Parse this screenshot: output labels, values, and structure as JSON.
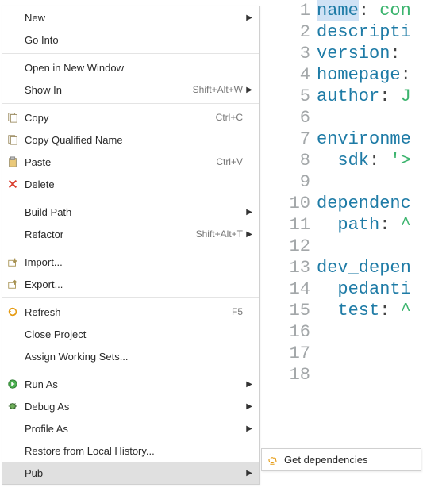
{
  "menu": {
    "groups": [
      [
        {
          "id": "new",
          "label": "New",
          "submenu": true,
          "icon": null,
          "accel": null
        },
        {
          "id": "go-into",
          "label": "Go Into",
          "submenu": false,
          "icon": null,
          "accel": null
        }
      ],
      [
        {
          "id": "open-new-window",
          "label": "Open in New Window",
          "submenu": false,
          "icon": null,
          "accel": null
        },
        {
          "id": "show-in",
          "label": "Show In",
          "submenu": true,
          "icon": null,
          "accel": "Shift+Alt+W"
        }
      ],
      [
        {
          "id": "copy",
          "label": "Copy",
          "submenu": false,
          "icon": "copy",
          "accel": "Ctrl+C"
        },
        {
          "id": "copy-qualified",
          "label": "Copy Qualified Name",
          "submenu": false,
          "icon": "copy",
          "accel": null
        },
        {
          "id": "paste",
          "label": "Paste",
          "submenu": false,
          "icon": "paste",
          "accel": "Ctrl+V"
        },
        {
          "id": "delete",
          "label": "Delete",
          "submenu": false,
          "icon": "delete",
          "accel": null
        }
      ],
      [
        {
          "id": "build-path",
          "label": "Build Path",
          "submenu": true,
          "icon": null,
          "accel": null
        },
        {
          "id": "refactor",
          "label": "Refactor",
          "submenu": true,
          "icon": null,
          "accel": "Shift+Alt+T"
        }
      ],
      [
        {
          "id": "import",
          "label": "Import...",
          "submenu": false,
          "icon": "import",
          "accel": null
        },
        {
          "id": "export",
          "label": "Export...",
          "submenu": false,
          "icon": "export",
          "accel": null
        }
      ],
      [
        {
          "id": "refresh",
          "label": "Refresh",
          "submenu": false,
          "icon": "refresh",
          "accel": "F5"
        },
        {
          "id": "close-project",
          "label": "Close Project",
          "submenu": false,
          "icon": null,
          "accel": null
        },
        {
          "id": "assign-working-sets",
          "label": "Assign Working Sets...",
          "submenu": false,
          "icon": null,
          "accel": null
        }
      ],
      [
        {
          "id": "run-as",
          "label": "Run As",
          "submenu": true,
          "icon": "run",
          "accel": null
        },
        {
          "id": "debug-as",
          "label": "Debug As",
          "submenu": true,
          "icon": "debug",
          "accel": null
        },
        {
          "id": "profile-as",
          "label": "Profile As",
          "submenu": true,
          "icon": null,
          "accel": null
        },
        {
          "id": "restore-history",
          "label": "Restore from Local History...",
          "submenu": false,
          "icon": null,
          "accel": null
        },
        {
          "id": "pub",
          "label": "Pub",
          "submenu": true,
          "icon": null,
          "accel": null,
          "highlighted": true
        }
      ]
    ]
  },
  "submenu_pub": {
    "items": [
      {
        "id": "get-deps",
        "label": "Get dependencies",
        "icon": "pub"
      }
    ]
  },
  "editor": {
    "lines": [
      {
        "n": 1,
        "tokens": [
          {
            "t": "name",
            "c": "key",
            "sel": true
          },
          {
            "t": ": ",
            "c": "colon"
          },
          {
            "t": "con",
            "c": "val"
          }
        ]
      },
      {
        "n": 2,
        "tokens": [
          {
            "t": "descripti",
            "c": "key"
          }
        ]
      },
      {
        "n": 3,
        "tokens": [
          {
            "t": "version",
            "c": "key"
          },
          {
            "t": ":",
            "c": "colon"
          }
        ]
      },
      {
        "n": 4,
        "tokens": [
          {
            "t": "homepage",
            "c": "key"
          },
          {
            "t": ":",
            "c": "colon"
          }
        ]
      },
      {
        "n": 5,
        "tokens": [
          {
            "t": "author",
            "c": "key"
          },
          {
            "t": ": ",
            "c": "colon"
          },
          {
            "t": "J",
            "c": "val"
          }
        ]
      },
      {
        "n": 6,
        "tokens": []
      },
      {
        "n": 7,
        "tokens": [
          {
            "t": "environme",
            "c": "key"
          }
        ]
      },
      {
        "n": 8,
        "tokens": [
          {
            "t": "  ",
            "c": "colon"
          },
          {
            "t": "sdk",
            "c": "key"
          },
          {
            "t": ": ",
            "c": "colon"
          },
          {
            "t": "'>",
            "c": "val"
          }
        ]
      },
      {
        "n": 9,
        "tokens": []
      },
      {
        "n": 10,
        "tokens": [
          {
            "t": "dependenc",
            "c": "key"
          }
        ]
      },
      {
        "n": 11,
        "tokens": [
          {
            "t": "  ",
            "c": "colon"
          },
          {
            "t": "path",
            "c": "key"
          },
          {
            "t": ": ",
            "c": "colon"
          },
          {
            "t": "^",
            "c": "val"
          }
        ]
      },
      {
        "n": 12,
        "tokens": []
      },
      {
        "n": 13,
        "tokens": [
          {
            "t": "dev_depen",
            "c": "key"
          }
        ]
      },
      {
        "n": 14,
        "tokens": [
          {
            "t": "  ",
            "c": "colon"
          },
          {
            "t": "pedanti",
            "c": "key"
          }
        ]
      },
      {
        "n": 15,
        "tokens": [
          {
            "t": "  ",
            "c": "colon"
          },
          {
            "t": "test",
            "c": "key"
          },
          {
            "t": ": ",
            "c": "colon"
          },
          {
            "t": "^",
            "c": "val"
          }
        ]
      },
      {
        "n": 16,
        "tokens": []
      },
      {
        "n": 17,
        "tokens": []
      },
      {
        "n": 18,
        "tokens": []
      }
    ]
  }
}
